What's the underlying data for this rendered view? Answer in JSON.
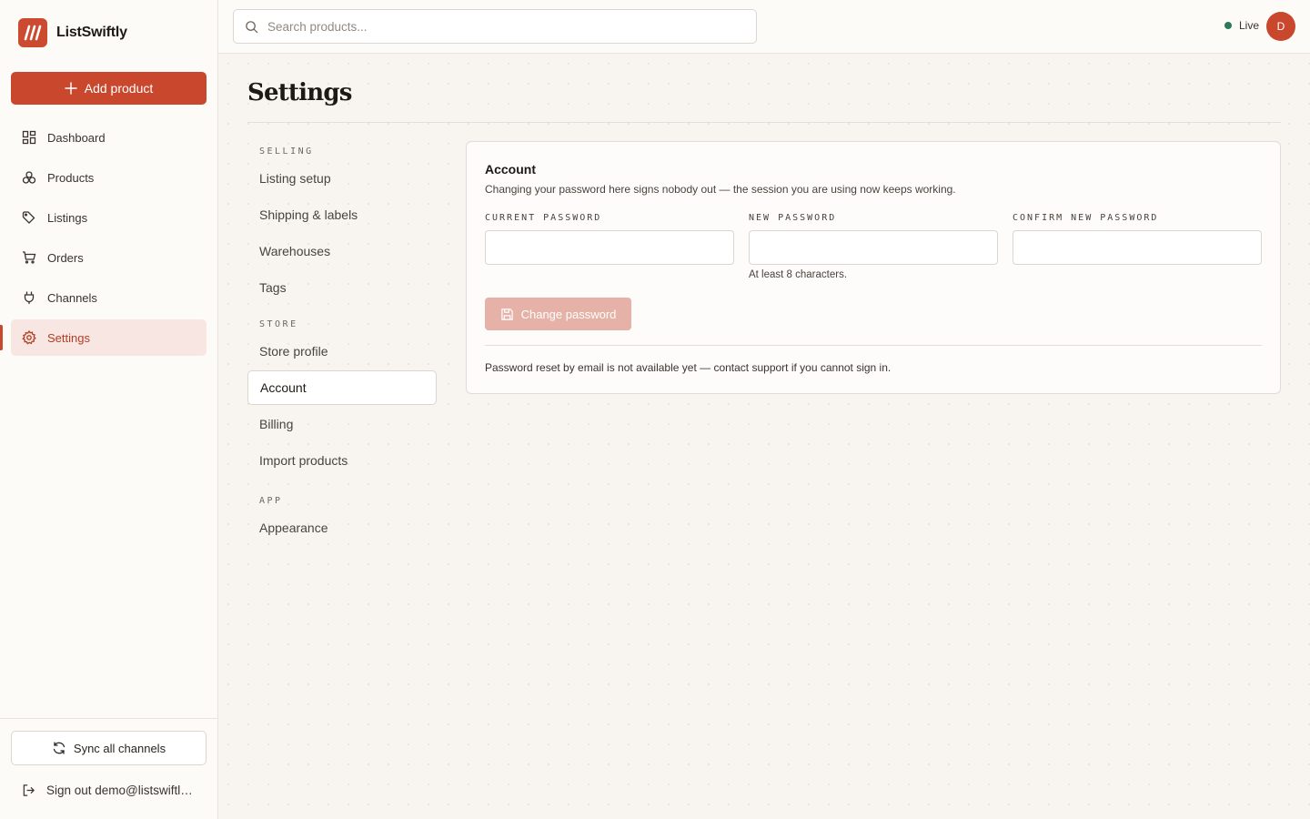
{
  "app": {
    "name": "ListSwiftly",
    "brand_color": "#c9472d"
  },
  "sidebar": {
    "add_product_label": "Add product",
    "items": [
      {
        "label": "Dashboard",
        "icon": "dashboard-icon"
      },
      {
        "label": "Products",
        "icon": "products-icon"
      },
      {
        "label": "Listings",
        "icon": "tag-icon"
      },
      {
        "label": "Orders",
        "icon": "cart-icon"
      },
      {
        "label": "Channels",
        "icon": "plug-icon"
      },
      {
        "label": "Settings",
        "icon": "gear-icon",
        "active": true
      }
    ],
    "sync_label": "Sync all channels",
    "signout_label": "Sign out demo@listswiftly.com"
  },
  "topbar": {
    "search_placeholder": "Search products...",
    "status_label": "Live",
    "status_color": "#2d7a58",
    "avatar_initial": "D"
  },
  "page": {
    "title": "Settings"
  },
  "subnav": {
    "groups": [
      {
        "label": "SELLING",
        "items": [
          "Listing setup",
          "Shipping & labels",
          "Warehouses",
          "Tags"
        ]
      },
      {
        "label": "STORE",
        "items": [
          "Store profile",
          "Account",
          "Billing",
          "Import products"
        ]
      },
      {
        "label": "APP",
        "items": [
          "Appearance"
        ]
      }
    ],
    "active": "Account"
  },
  "account": {
    "title": "Account",
    "description": "Changing your password here signs nobody out — the session you are using now keeps working.",
    "fields": {
      "current_label": "CURRENT PASSWORD",
      "new_label": "NEW PASSWORD",
      "new_hint": "At least 8 characters.",
      "confirm_label": "CONFIRM NEW PASSWORD"
    },
    "button_label": "Change password",
    "footer_note": "Password reset by email is not available yet — contact support if you cannot sign in."
  }
}
